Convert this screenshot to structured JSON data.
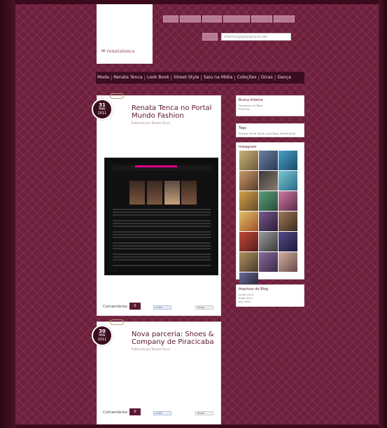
{
  "header": {
    "logo_text": "renatatenca",
    "top_tabs": [
      "",
      "",
      "",
      "",
      "",
      ""
    ],
    "search_placeholder": "eftermo@guiajaracia.net"
  },
  "nav": {
    "items": [
      "Moda",
      "Renata Tenca",
      "Look Book",
      "Street Style",
      "Saiu na Mídia",
      "Coleções",
      "Dicas",
      "Dança"
    ]
  },
  "posts": [
    {
      "date_day": "31",
      "date_month": "MAI",
      "date_year": "2011",
      "title": "Renata Tenca no Portal Mundo Fashion",
      "meta": "Publicado por Renata Tenca",
      "comments_label": "Comentários",
      "comments_count": "0",
      "like_label": "Curtir",
      "share_label": "Share"
    },
    {
      "date_day": "30",
      "date_month": "MAI",
      "date_year": "2011",
      "title": "Nova parceria: Shoes & Company de Piracicaba",
      "meta": "Publicado por Renata Tenca",
      "comments_label": "Comentários",
      "comments_count": "0",
      "like_label": "Curtir",
      "share_label": "Share"
    }
  ],
  "sidebar": {
    "search_title": "Busca Interna",
    "search_lines": [
      "Pesquisar no Blog",
      "Procurar"
    ],
    "tags_title": "Tags",
    "tags_line": "Renata Tenca Dicas Look Book Street Style",
    "insta_title": "Instagram",
    "archive_title": "Arquivos do Blog",
    "archive_items": [
      "junho 2011",
      "maio 2011",
      "abr 2011"
    ]
  },
  "colors": {
    "background": "#6e1f3c",
    "nav_bg": "#3a0d1f",
    "accent": "#5a1530",
    "tab": "#b57a92"
  }
}
